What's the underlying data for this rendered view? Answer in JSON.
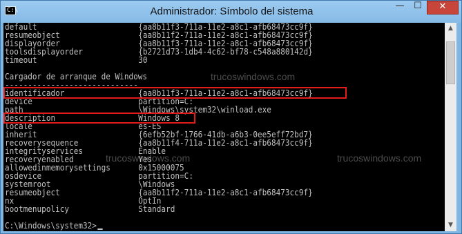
{
  "window": {
    "title": "Administrador: Símbolo del sistema",
    "icon_label": "C:\\",
    "controls": {
      "minimize": "—",
      "maximize": "☐",
      "close": "✕"
    }
  },
  "console": {
    "top_rows": [
      {
        "key": "default",
        "value": "{aa8b11f3-711a-11e2-a8c1-afb68473cc9f}"
      },
      {
        "key": "resumeobject",
        "value": "{aa8b11f2-711a-11e2-a8c1-afb68473cc9f}"
      },
      {
        "key": "displayorder",
        "value": "{aa8b11f3-711a-11e2-a8c1-afb68473cc9f}"
      },
      {
        "key": "toolsdisplayorder",
        "value": "{b2721d73-1db4-4c62-bf78-c548a880142d}"
      },
      {
        "key": "timeout",
        "value": "30"
      }
    ],
    "section_header": "Cargador de arranque de Windows",
    "section_underline": "-----------------------------",
    "rows": [
      {
        "key": "identificador",
        "value": "{aa8b11f3-711a-11e2-a8c1-afb68473cc9f}"
      },
      {
        "key": "device",
        "value": "partition=C:"
      },
      {
        "key": "path",
        "value": "\\Windows\\system32\\winload.exe"
      },
      {
        "key": "description",
        "value": "Windows 8"
      },
      {
        "key": "locale",
        "value": "es-ES"
      },
      {
        "key": "inherit",
        "value": "{6efb52bf-1766-41db-a6b3-0ee5eff72bd7}"
      },
      {
        "key": "recoverysequence",
        "value": "{aa8b11f4-711a-11e2-a8c1-afb68473cc9f}"
      },
      {
        "key": "integrityservices",
        "value": "Enable"
      },
      {
        "key": "recoveryenabled",
        "value": "Yes"
      },
      {
        "key": "allowedinmemorysettings",
        "value": "0x15000075"
      },
      {
        "key": "osdevice",
        "value": "partition=C:"
      },
      {
        "key": "systemroot",
        "value": "\\Windows"
      },
      {
        "key": "resumeobject",
        "value": "{aa8b11f2-711a-11e2-a8c1-afb68473cc9f}"
      },
      {
        "key": "nx",
        "value": "OptIn"
      },
      {
        "key": "bootmenupolicy",
        "value": "Standard"
      }
    ],
    "prompt": "C:\\Windows\\system32>",
    "watermarks": [
      "trucoswindows.com",
      "trucoswindows.com",
      "trucoswindows.com"
    ]
  }
}
